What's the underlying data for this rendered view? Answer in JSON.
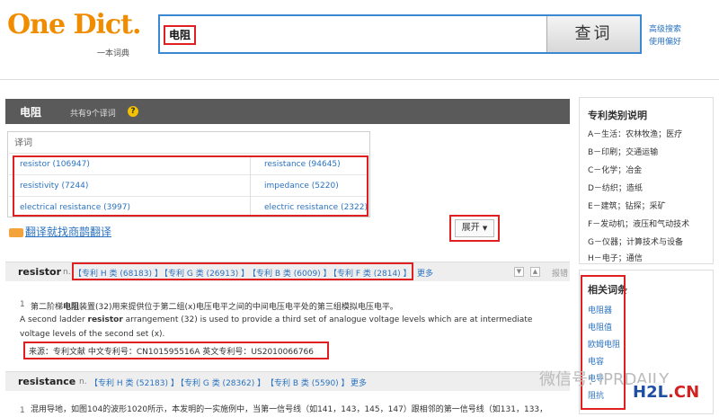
{
  "logo": {
    "main": "One Dict.",
    "sub": "一本词典"
  },
  "search": {
    "query": "电阻",
    "button": "查词",
    "adv_search": "高级搜索",
    "prefs": "使用偏好"
  },
  "header": {
    "title": "电阻",
    "count": "共有9个译词",
    "help": "?"
  },
  "words": {
    "label": "译词",
    "items": [
      "resistor (106947)",
      "resistance (94645)",
      "resistivity (7244)",
      "impedance (5220)",
      "electrical resistance (3997)",
      "electric resistance (2322)"
    ]
  },
  "translate_link": "翻译就找商鹊翻译",
  "expand_button": "展开",
  "entries": [
    {
      "word": "resistor",
      "pos": "n.",
      "classes": [
        "【专利 H 类 (68183) 】",
        "【专利 G 类 (26913) 】",
        "【专利 B 类 (6009) 】",
        "【专利 F 类 (2814) 】"
      ],
      "more": "更多",
      "report": "报错"
    },
    {
      "word": "resistance",
      "pos": "n.",
      "classes": [
        "【专利 H 类 (52183) 】",
        "【专利 G 类 (28362) 】",
        "【专利 B 类 (5590) 】"
      ],
      "more": "更多"
    }
  ],
  "example": {
    "num": "1",
    "cn_before": "第二阶梯",
    "cn_bold": "电阻",
    "cn_after": "装置(32)用来提供位于第二组(x)电压电平之间的中间电压电平处的第三组模拟电压电平。",
    "en_before": "A second ladder ",
    "en_bold": "resistor",
    "en_after": " arrangement (32) is used to provide a third set of analogue voltage levels which are at intermediate voltage levels of the second set (x).",
    "source": "来源：专利文献   中文专利号：CN101595516A   英文专利号：US2010066766"
  },
  "example2": {
    "num": "1",
    "text": "混用导地，如图104的波形1020所示，本发明的一实施例中，当第一信号线（如141，143，145，147）跟相邻的第一信号线（如131，133，"
  },
  "sidebar": {
    "categories_title": "专利类别说明",
    "categories": [
      "A－生活：农林牧渔；医疗",
      "B－印刷；交通运输",
      "C－化学；冶金",
      "D－纺织；造纸",
      "E－建筑；钻探；采矿",
      "F－发动机；液压和气动技术",
      "G－仪器；计算技术与设备",
      "H－电子；通信"
    ],
    "related_title": "相关词条",
    "related": [
      "电阻器",
      "电阻值",
      "欧姆电阻",
      "电容",
      "电导",
      "阻抗"
    ]
  },
  "watermark": {
    "text": "微信号: IPRDAILY",
    "logo_a": "H2L",
    "logo_b": ".CN"
  },
  "colors": {
    "accent": "#3a88d2",
    "highlight": "#e02020",
    "link": "#2a72c0",
    "brand": "#f08c00"
  }
}
